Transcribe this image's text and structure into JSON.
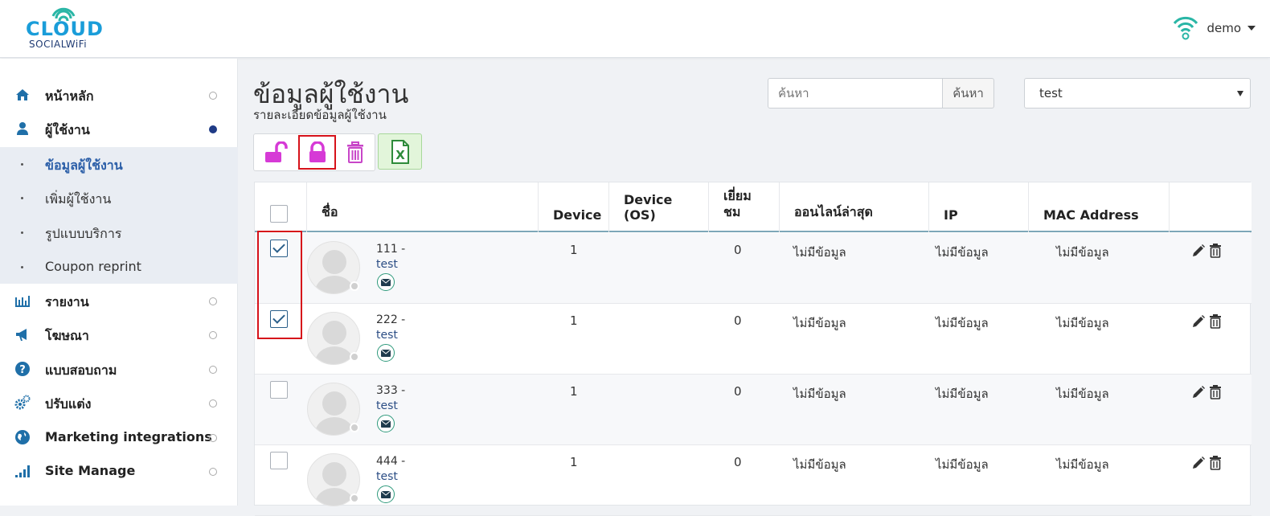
{
  "header": {
    "logo_main": "CLOUD",
    "logo_sub": "SOCIALWiFi",
    "user_name": "demo"
  },
  "sidebar": {
    "items": [
      {
        "label": "หน้าหลัก",
        "icon": "home-icon",
        "active": false
      },
      {
        "label": "ผู้ใช้งาน",
        "icon": "user-icon",
        "active": true
      },
      {
        "label": "รายงาน",
        "icon": "bar-chart-icon",
        "active": false
      },
      {
        "label": "โฆษณา",
        "icon": "megaphone-icon",
        "active": false
      },
      {
        "label": "แบบสอบถาม",
        "icon": "question-icon",
        "active": false
      },
      {
        "label": "ปรับแต่ง",
        "icon": "gears-icon",
        "active": false
      },
      {
        "label": "Marketing integrations",
        "icon": "globe-icon",
        "active": false
      },
      {
        "label": "Site Manage",
        "icon": "signal-icon",
        "active": false
      }
    ],
    "sub_items": [
      {
        "label": "ข้อมูลผู้ใช้งาน",
        "active": true
      },
      {
        "label": "เพิ่มผู้ใช้งาน",
        "active": false
      },
      {
        "label": "รูปแบบบริการ",
        "active": false
      },
      {
        "label": "Coupon reprint",
        "active": false
      }
    ]
  },
  "main": {
    "title": "ข้อมูลผู้ใช้งาน",
    "subtitle": "รายละเอียดข้อมูลผู้ใช้งาน",
    "search": {
      "placeholder": "ค้นหา",
      "button_label": "ค้นหา"
    },
    "site_select": {
      "value": "test"
    },
    "toolbar": {
      "unlock_icon": "unlock-icon",
      "lock_icon": "lock-icon",
      "delete_icon": "trash-icon",
      "export_icon": "excel-icon"
    },
    "table": {
      "headers": [
        "ชื่อ",
        "Device",
        "Device (OS)",
        "เยี่ยม ชม",
        "ออนไลน์ล่าสุด",
        "IP",
        "MAC Address"
      ],
      "visit_header_line1": "เยี่ยม",
      "visit_header_line2": "ชม",
      "rows": [
        {
          "id": "111 -",
          "site": "test",
          "device": "1",
          "device_os": "",
          "visits": "0",
          "last_online": "ไม่มีข้อมูล",
          "ip": "ไม่มีข้อมูล",
          "mac": "ไม่มีข้อมูล",
          "checked": true
        },
        {
          "id": "222 -",
          "site": "test",
          "device": "1",
          "device_os": "",
          "visits": "0",
          "last_online": "ไม่มีข้อมูล",
          "ip": "ไม่มีข้อมูล",
          "mac": "ไม่มีข้อมูล",
          "checked": true
        },
        {
          "id": "333 -",
          "site": "test",
          "device": "1",
          "device_os": "",
          "visits": "0",
          "last_online": "ไม่มีข้อมูล",
          "ip": "ไม่มีข้อมูล",
          "mac": "ไม่มีข้อมูล",
          "checked": false
        },
        {
          "id": "444 -",
          "site": "test",
          "device": "1",
          "device_os": "",
          "visits": "0",
          "last_online": "ไม่มีข้อมูล",
          "ip": "ไม่มีข้อมูล",
          "mac": "ไม่มีข้อมูล",
          "checked": false
        }
      ]
    }
  },
  "colors": {
    "brand_blue": "#1a9dd9",
    "brand_navy": "#1f3b73",
    "lock_magenta": "#d63ad6",
    "highlight_red": "#d6121a",
    "excel_green": "#2e8b3a"
  }
}
